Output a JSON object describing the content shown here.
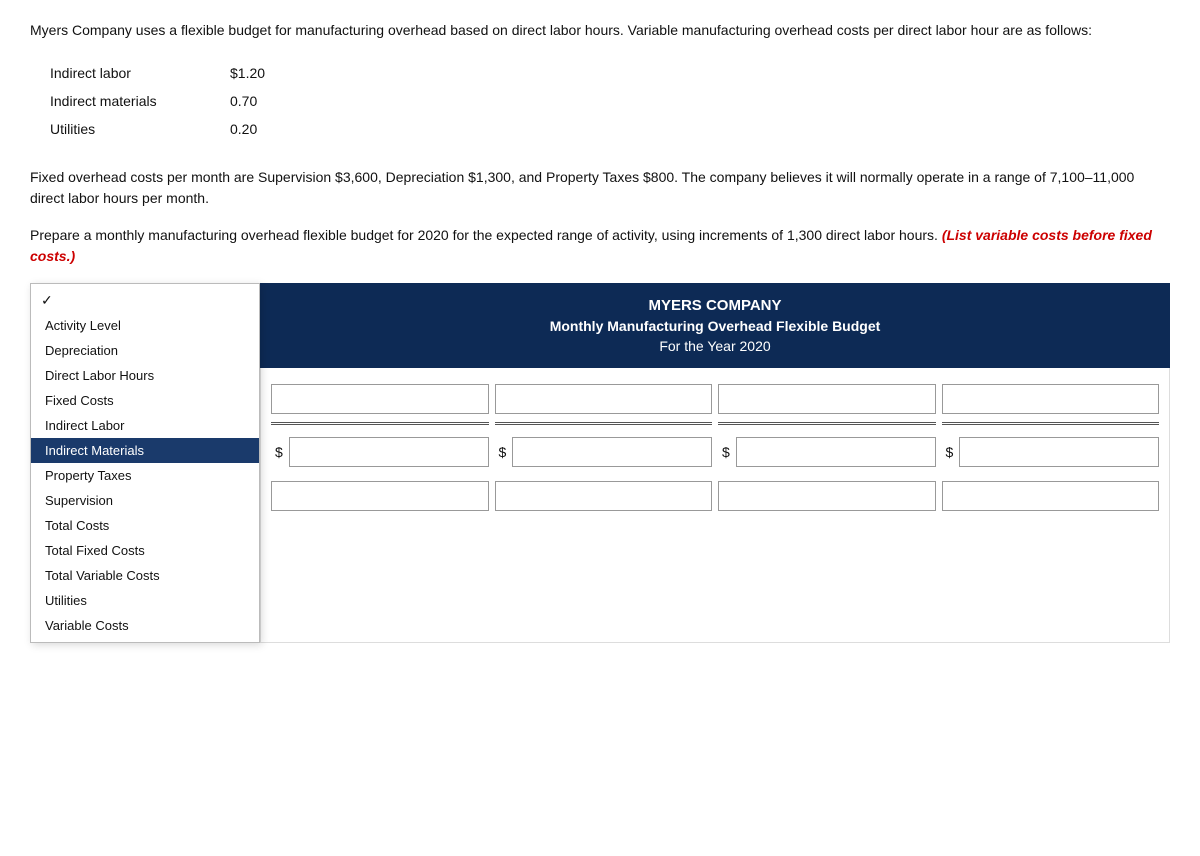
{
  "intro": {
    "paragraph1": "Myers Company uses a flexible budget for manufacturing overhead based on direct labor hours. Variable manufacturing overhead costs per direct labor hour are as follows:",
    "variable_costs": [
      {
        "label": "Indirect labor",
        "value": "$1.20"
      },
      {
        "label": "Indirect materials",
        "value": "0.70"
      },
      {
        "label": "Utilities",
        "value": "0.20"
      }
    ],
    "paragraph2": "Fixed overhead costs per month are Supervision $3,600, Depreciation $1,300, and Property Taxes $800. The company believes it will normally operate in a range of 7,100–11,000 direct labor hours per month.",
    "paragraph3_start": "Prepare a monthly manufacturing overhead flexible budget for 2020 for the expected range of activity, using increments of 1,300 direct labor hours. ",
    "paragraph3_italic": "(List variable costs before fixed costs.)"
  },
  "dropdown": {
    "checkmark": "✓",
    "items": [
      {
        "label": "Activity Level",
        "selected": false
      },
      {
        "label": "Depreciation",
        "selected": false
      },
      {
        "label": "Direct Labor Hours",
        "selected": false
      },
      {
        "label": "Fixed Costs",
        "selected": false
      },
      {
        "label": "Indirect Labor",
        "selected": false
      },
      {
        "label": "Indirect Materials",
        "selected": true
      },
      {
        "label": "Property Taxes",
        "selected": false
      },
      {
        "label": "Supervision",
        "selected": false
      },
      {
        "label": "Total Costs",
        "selected": false
      },
      {
        "label": "Total Fixed Costs",
        "selected": false
      },
      {
        "label": "Total Variable Costs",
        "selected": false
      },
      {
        "label": "Utilities",
        "selected": false
      },
      {
        "label": "Variable Costs",
        "selected": false
      }
    ]
  },
  "table": {
    "company_name": "MYERS COMPANY",
    "report_title": "Monthly Manufacturing Overhead Flexible Budget",
    "report_period": "For the Year 2020",
    "dollar_sign": "$",
    "columns": 4,
    "inputs": [
      "",
      "",
      "",
      ""
    ]
  }
}
